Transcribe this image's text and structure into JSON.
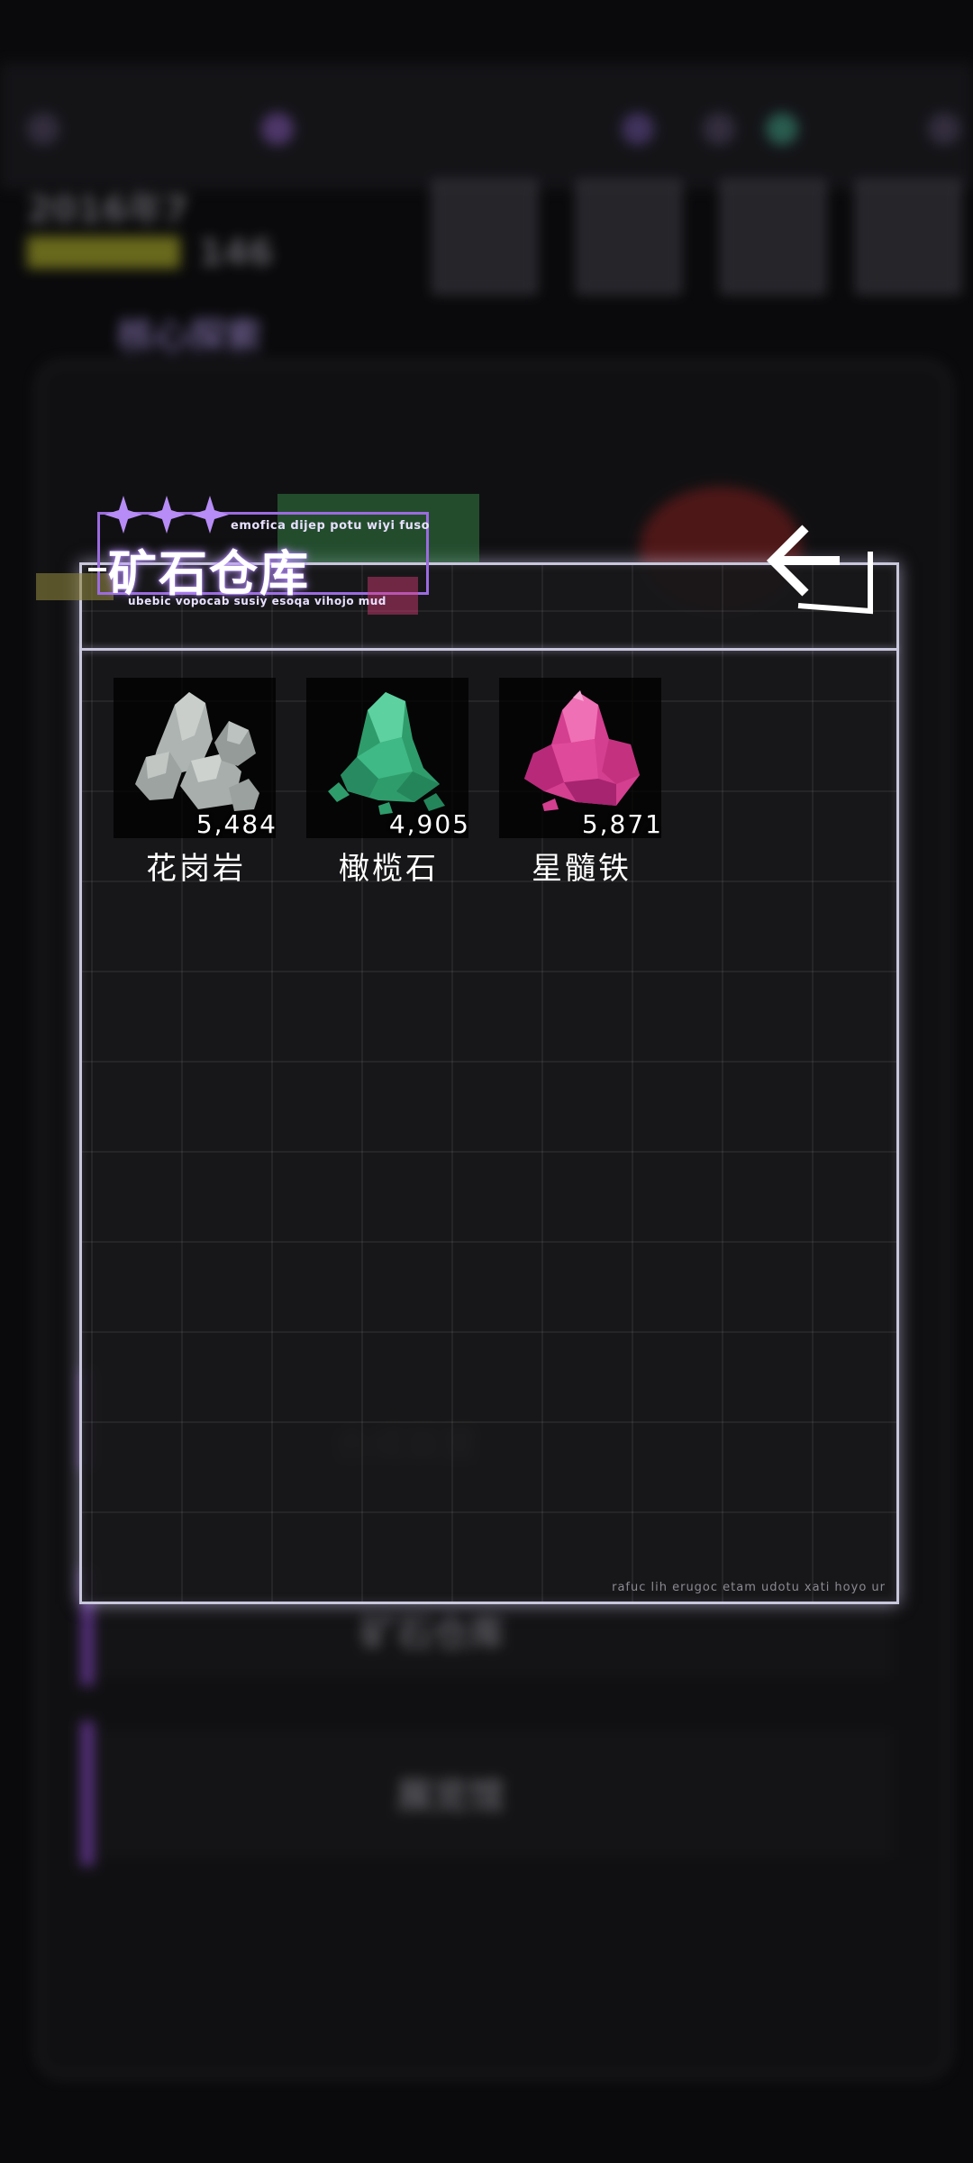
{
  "dialog": {
    "title": "矿石仓库",
    "subtitle_top": "emofica dijep potu wiyi fuso",
    "subtitle_bottom": "ubebic vopocab susiy esoqa vihojo mud",
    "footer": "rafuc lih erugoc etam udotu xati hoyo ur",
    "back_icon": "back-arrow-icon"
  },
  "inventory": {
    "items": [
      {
        "name": "花岗岩",
        "count": "5,484",
        "icon": "granite-ore-icon",
        "color": "#a9b0ac"
      },
      {
        "name": "橄榄石",
        "count": "4,905",
        "icon": "olivine-ore-icon",
        "color": "#3fb985"
      },
      {
        "name": "星髓铁",
        "count": "5,871",
        "icon": "star-iron-ore-icon",
        "color": "#e04a9a"
      }
    ]
  },
  "colors": {
    "accent": "#b78cf6",
    "panel_border": "#c9c7dc"
  }
}
